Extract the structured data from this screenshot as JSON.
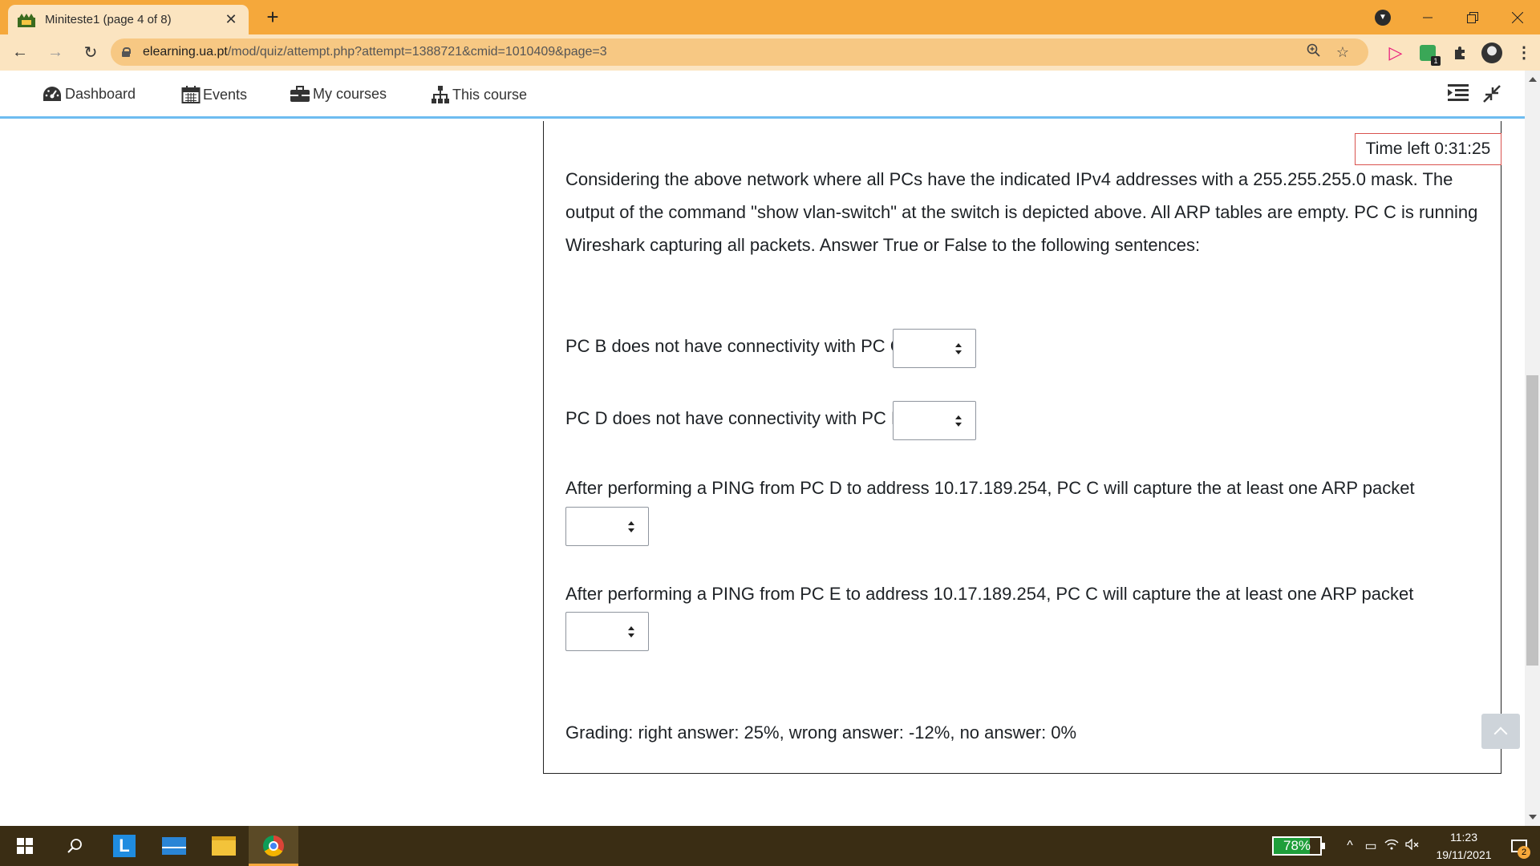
{
  "browser": {
    "tab_title": "Miniteste1 (page 4 of 8)",
    "tab_close": "✕",
    "new_tab": "+",
    "url_host": "elearning.ua.pt",
    "url_path": "/mod/quiz/attempt.php?attempt=1388721&cmid=1010409&page=3"
  },
  "nav": {
    "dashboard": "Dashboard",
    "events": "Events",
    "my_courses": "My courses",
    "this_course": "This course"
  },
  "quiz": {
    "timer": "Time left 0:31:25",
    "question_text": "Considering the above network where all PCs have the indicated IPv4 addresses with a 255.255.255.0 mask. The output of the command \"show vlan-switch\" at the switch is depicted above. All ARP tables are empty. PC C is running Wireshark capturing all packets. Answer True or False to the following sentences:",
    "statements": [
      {
        "text": "PC B does not have connectivity with PC C",
        "selected": ""
      },
      {
        "text": "PC D does not have connectivity with PC E",
        "selected": ""
      },
      {
        "text": "After performing a PING from PC D to address 10.17.189.254, PC C will capture the at least one ARP packet",
        "selected": ""
      },
      {
        "text": "After performing a PING from PC E to address 10.17.189.254, PC C will capture the at least one ARP packet",
        "selected": ""
      }
    ],
    "grading": "Grading: right answer: 25%, wrong answer: -12%, no answer: 0%"
  },
  "taskbar": {
    "battery_percent": 78,
    "battery_label": "78%",
    "time": "11:23",
    "date": "19/11/2021",
    "notification_count": "2"
  },
  "colors": {
    "tabbar": "#f5a83b",
    "toolbar": "#fbe4c0",
    "nav_underline": "#6ebcf0",
    "timer_border": "#d9534f",
    "taskbar": "#3a2d14"
  }
}
